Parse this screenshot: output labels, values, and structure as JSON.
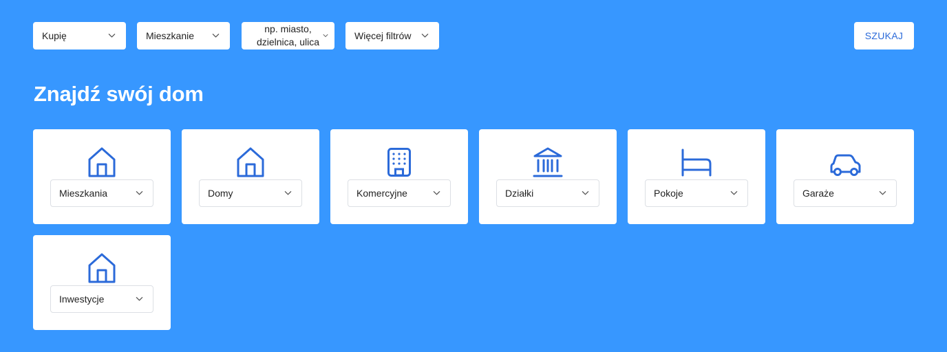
{
  "filters": {
    "transaction": "Kupię",
    "property_type": "Mieszkanie",
    "location_placeholder": "np. miasto, dzielnica, ulica",
    "more_filters": "Więcej filtrów",
    "search_button": "SZUKAJ"
  },
  "heading": "Znajdź swój dom",
  "categories": [
    {
      "label": "Mieszkania",
      "icon": "home-icon"
    },
    {
      "label": "Domy",
      "icon": "home-icon"
    },
    {
      "label": "Komercyjne",
      "icon": "building-icon"
    },
    {
      "label": "Działki",
      "icon": "landmark-icon"
    },
    {
      "label": "Pokoje",
      "icon": "bed-icon"
    },
    {
      "label": "Garaże",
      "icon": "car-icon"
    },
    {
      "label": "Inwestycje",
      "icon": "home-icon"
    }
  ],
  "colors": {
    "background": "#3797ff",
    "accent": "#2b6ad9",
    "card": "#ffffff"
  }
}
